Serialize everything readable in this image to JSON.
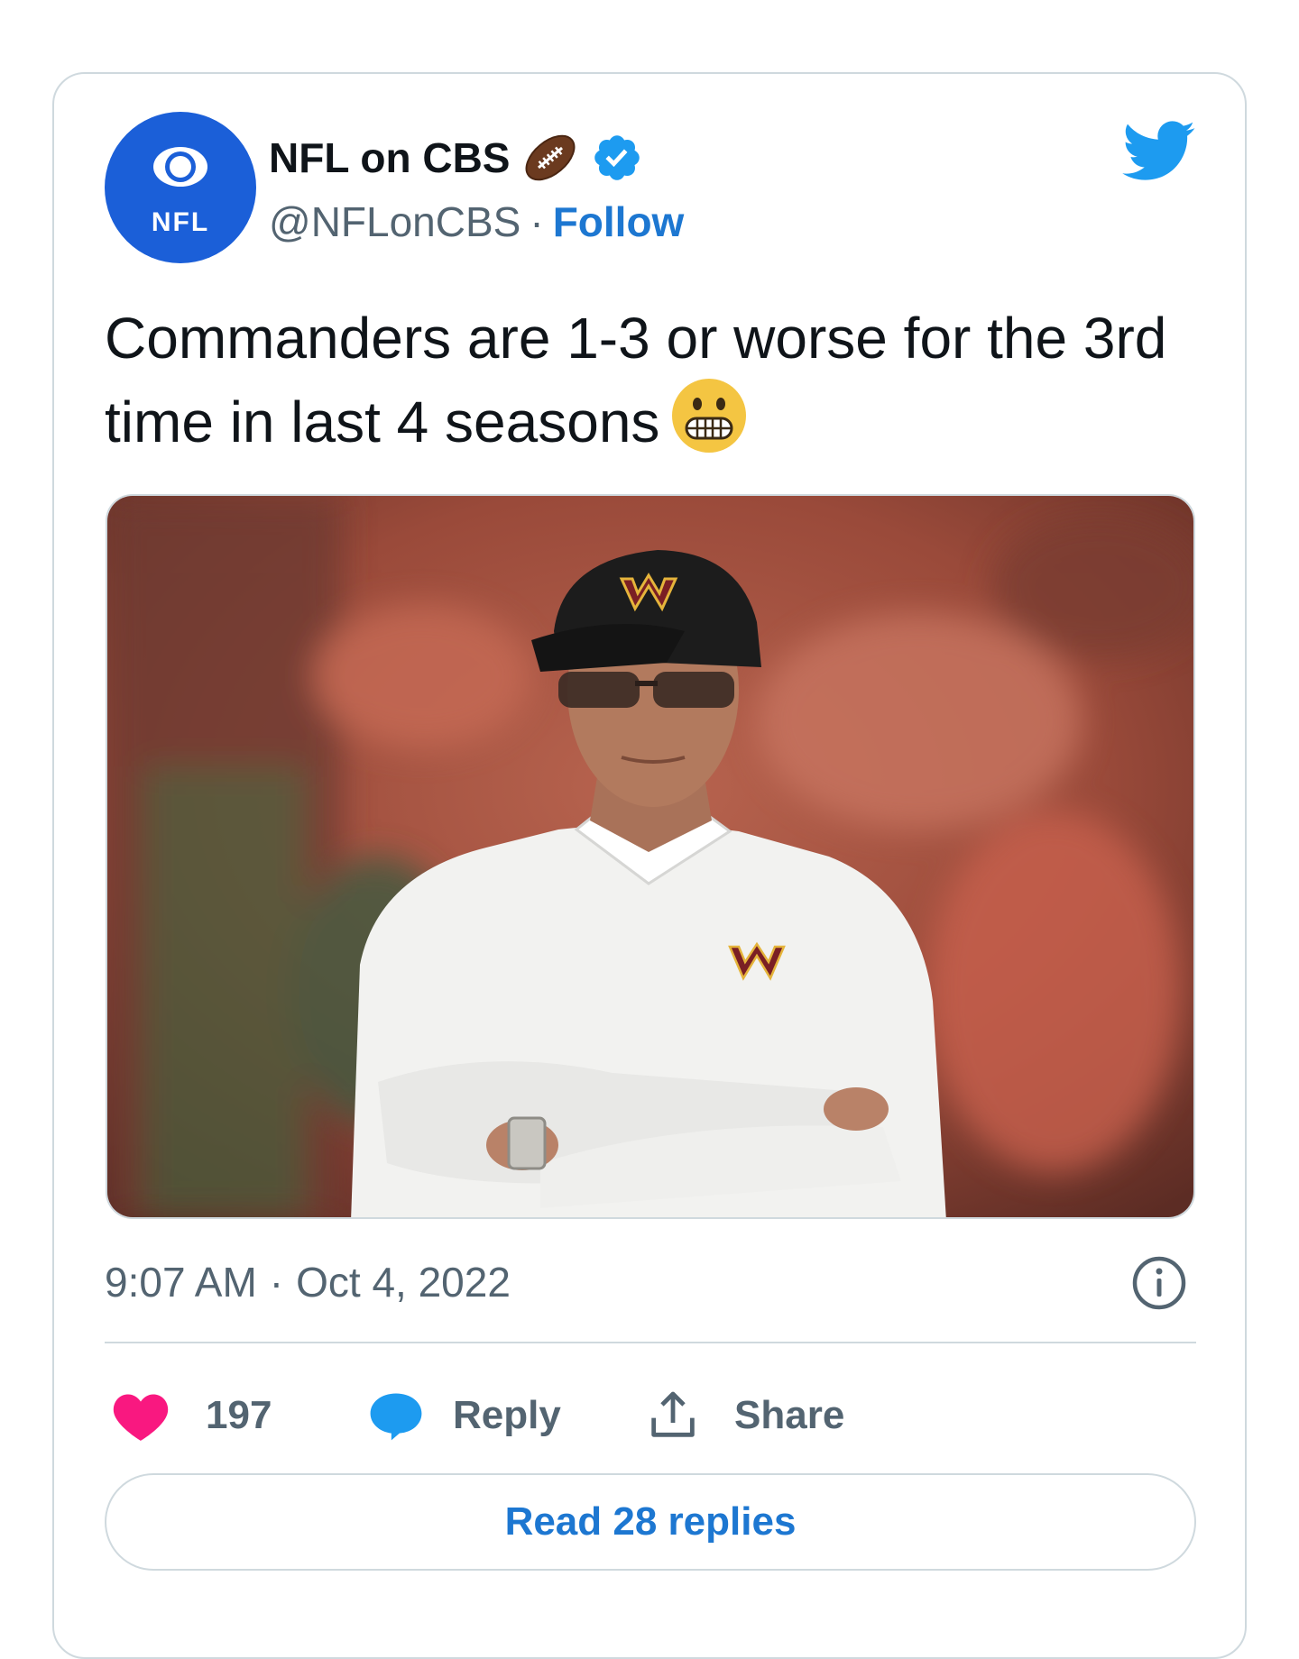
{
  "author": {
    "display_name": "NFL on CBS",
    "handle": "@NFLonCBS",
    "separator": "·",
    "follow_label": "Follow",
    "avatar_text": "NFL",
    "verified": true
  },
  "icons": {
    "name_emoji": "football-icon",
    "verified": "verified-badge-icon",
    "brand": "twitter-bird-icon",
    "text_emoji": "grimacing-face-icon",
    "info": "info-icon",
    "like": "heart-icon",
    "reply": "speech-bubble-icon",
    "share": "share-upload-icon"
  },
  "tweet": {
    "text": "Commanders are 1-3 or worse for the 3rd time in last 4 seasons",
    "time": "9:07 AM",
    "separator": "·",
    "date": "Oct 4, 2022"
  },
  "actions": {
    "like_count": "197",
    "reply_label": "Reply",
    "share_label": "Share",
    "read_replies_label": "Read 28 replies"
  },
  "colors": {
    "brand_blue": "#1d9bf0",
    "link_blue": "#1d77d1",
    "like_pink": "#f91880",
    "secondary_text": "#536471",
    "border": "#cfd9de",
    "avatar_blue": "#1b5fd8"
  }
}
